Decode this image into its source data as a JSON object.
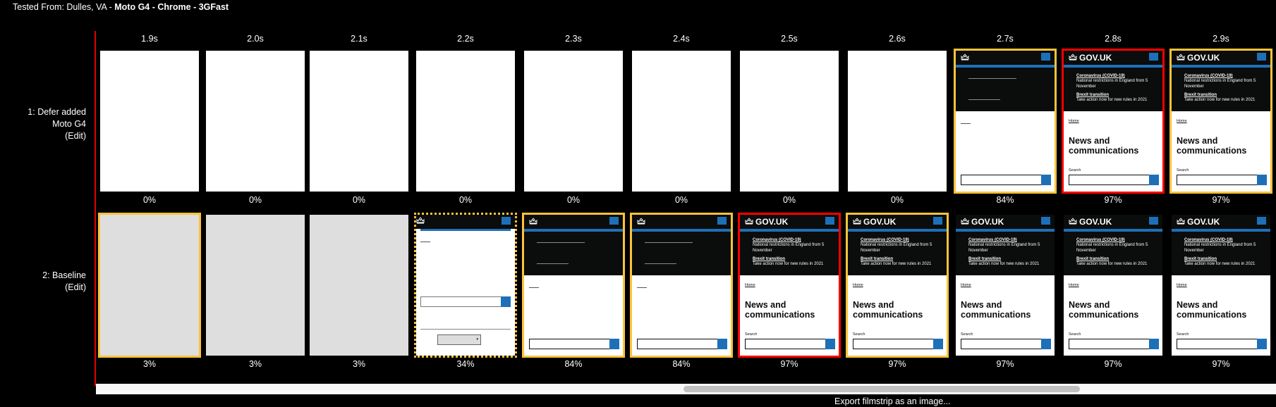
{
  "header": {
    "tested_from_prefix": "Tested From: Dulles, VA - ",
    "tested_from_config": "Moto G4 - Chrome - 3GFast"
  },
  "timeline": {
    "times": [
      "1.9s",
      "2.0s",
      "2.1s",
      "2.2s",
      "2.3s",
      "2.4s",
      "2.5s",
      "2.6s",
      "2.7s",
      "2.8s",
      "2.9s"
    ]
  },
  "page_content": {
    "logo_text": "GOV.UK",
    "crown_icon": "crown-icon",
    "banner_link_1": "Coronavirus (COVID-19)",
    "banner_text_1": "National restrictions in England from 5 November",
    "banner_link_2": "Brexit transition",
    "banner_text_2": "Take action now for new rules in 2021",
    "breadcrumb": "Home",
    "title": "News and communications",
    "search_label": "Search",
    "select_arrow": "▾"
  },
  "rows": [
    {
      "label_line1": "1: Defer added",
      "label_line2": "Moto G4",
      "edit_label": "(Edit)",
      "frames": [
        {
          "state": "blank-white",
          "border": "none",
          "visual_complete": "0%"
        },
        {
          "state": "blank-white",
          "border": "none",
          "visual_complete": "0%"
        },
        {
          "state": "blank-white",
          "border": "none",
          "visual_complete": "0%"
        },
        {
          "state": "blank-white",
          "border": "none",
          "visual_complete": "0%"
        },
        {
          "state": "blank-white",
          "border": "none",
          "visual_complete": "0%"
        },
        {
          "state": "blank-white",
          "border": "none",
          "visual_complete": "0%"
        },
        {
          "state": "blank-white",
          "border": "none",
          "visual_complete": "0%"
        },
        {
          "state": "blank-white",
          "border": "none",
          "visual_complete": "0%"
        },
        {
          "state": "skeleton",
          "border": "yellow",
          "visual_complete": "84%"
        },
        {
          "state": "complete",
          "border": "red",
          "visual_complete": "97%"
        },
        {
          "state": "complete",
          "border": "yellow",
          "visual_complete": "97%"
        }
      ]
    },
    {
      "label_line1": "2: Baseline",
      "label_line2": "",
      "edit_label": "(Edit)",
      "frames": [
        {
          "state": "blank-grey",
          "border": "yellow",
          "visual_complete": "3%"
        },
        {
          "state": "blank-grey",
          "border": "none",
          "visual_complete": "3%"
        },
        {
          "state": "blank-grey",
          "border": "none",
          "visual_complete": "3%"
        },
        {
          "state": "partial",
          "border": "dotted",
          "visual_complete": "34%"
        },
        {
          "state": "skeleton",
          "border": "yellow",
          "visual_complete": "84%"
        },
        {
          "state": "skeleton",
          "border": "yellow",
          "visual_complete": "84%"
        },
        {
          "state": "complete",
          "border": "red",
          "visual_complete": "97%"
        },
        {
          "state": "complete",
          "border": "yellow",
          "visual_complete": "97%"
        },
        {
          "state": "complete",
          "border": "none",
          "visual_complete": "97%"
        },
        {
          "state": "complete",
          "border": "none",
          "visual_complete": "97%"
        },
        {
          "state": "complete",
          "border": "none",
          "visual_complete": "97%"
        }
      ]
    }
  ],
  "colors": {
    "timeline_marker": "#e00000",
    "changed_frame_border": "#fcc33a",
    "visually_complete_border": "#ff0000",
    "gov_blue": "#1d70b8",
    "gov_black": "#0b0c0c"
  },
  "footer": {
    "export_label": "Export filmstrip as an image..."
  }
}
